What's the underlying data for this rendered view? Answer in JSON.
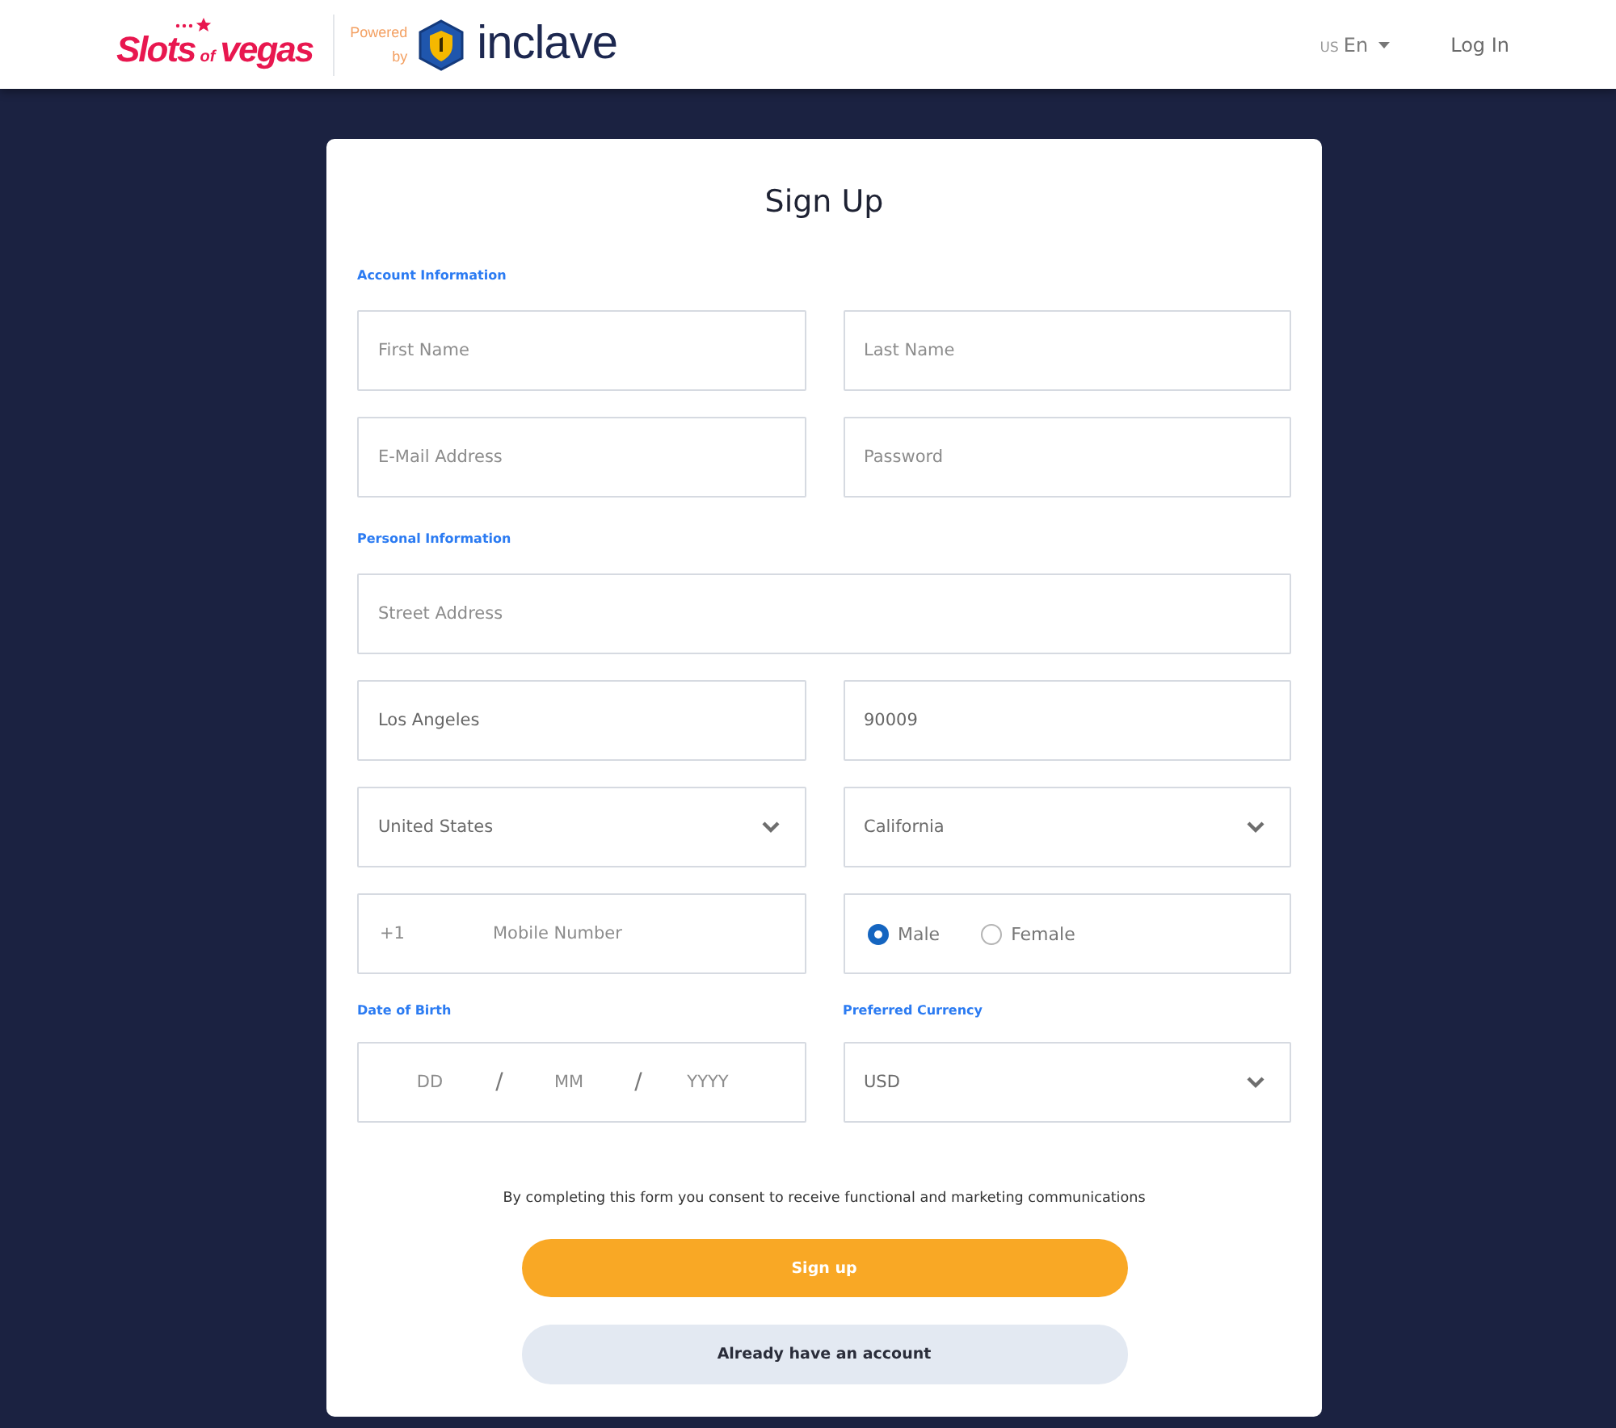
{
  "header": {
    "brand_words": [
      "Slots",
      "of",
      "vegas"
    ],
    "powered_by": "Powered by",
    "partner_name": "inclave",
    "language": {
      "region": "US",
      "code": "En"
    },
    "login_link": "Log In"
  },
  "form": {
    "title": "Sign Up",
    "sections": [
      {
        "heading": "Account Information",
        "rows": [
          [
            {
              "kind": "text",
              "placeholder": "First Name"
            },
            {
              "kind": "text",
              "placeholder": "Last Name"
            }
          ],
          [
            {
              "kind": "text",
              "placeholder": "E-Mail Address"
            },
            {
              "kind": "text",
              "placeholder": "Password"
            }
          ]
        ]
      },
      {
        "heading": "Personal Information",
        "rows": [
          [
            {
              "kind": "text",
              "placeholder": "Street Address"
            }
          ],
          [
            {
              "kind": "text",
              "value": "Los Angeles"
            },
            {
              "kind": "text",
              "value": "90009"
            }
          ],
          [
            {
              "kind": "select",
              "value": "United States"
            },
            {
              "kind": "select",
              "value": "California"
            }
          ],
          [
            {
              "kind": "phone",
              "prefix": "+1",
              "placeholder": "Mobile Number"
            },
            {
              "kind": "radio",
              "options": [
                {
                  "label": "Male",
                  "selected": true
                },
                {
                  "label": "Female",
                  "selected": false
                }
              ]
            }
          ],
          [
            {
              "kind": "date",
              "label": "Date of Birth",
              "parts": [
                {
                  "placeholder": "DD"
                },
                {
                  "placeholder": "MM"
                },
                {
                  "placeholder": "YYYY"
                }
              ],
              "separators": [
                "/",
                "/"
              ]
            },
            {
              "kind": "select",
              "label": "Preferred Currency",
              "value": "USD"
            }
          ]
        ]
      }
    ],
    "consent": "By completing this form you consent to receive functional and marketing communications",
    "buttons": [
      {
        "kind": "primary",
        "label": "Sign up"
      },
      {
        "kind": "secondary",
        "label": "Already have an account"
      }
    ]
  }
}
